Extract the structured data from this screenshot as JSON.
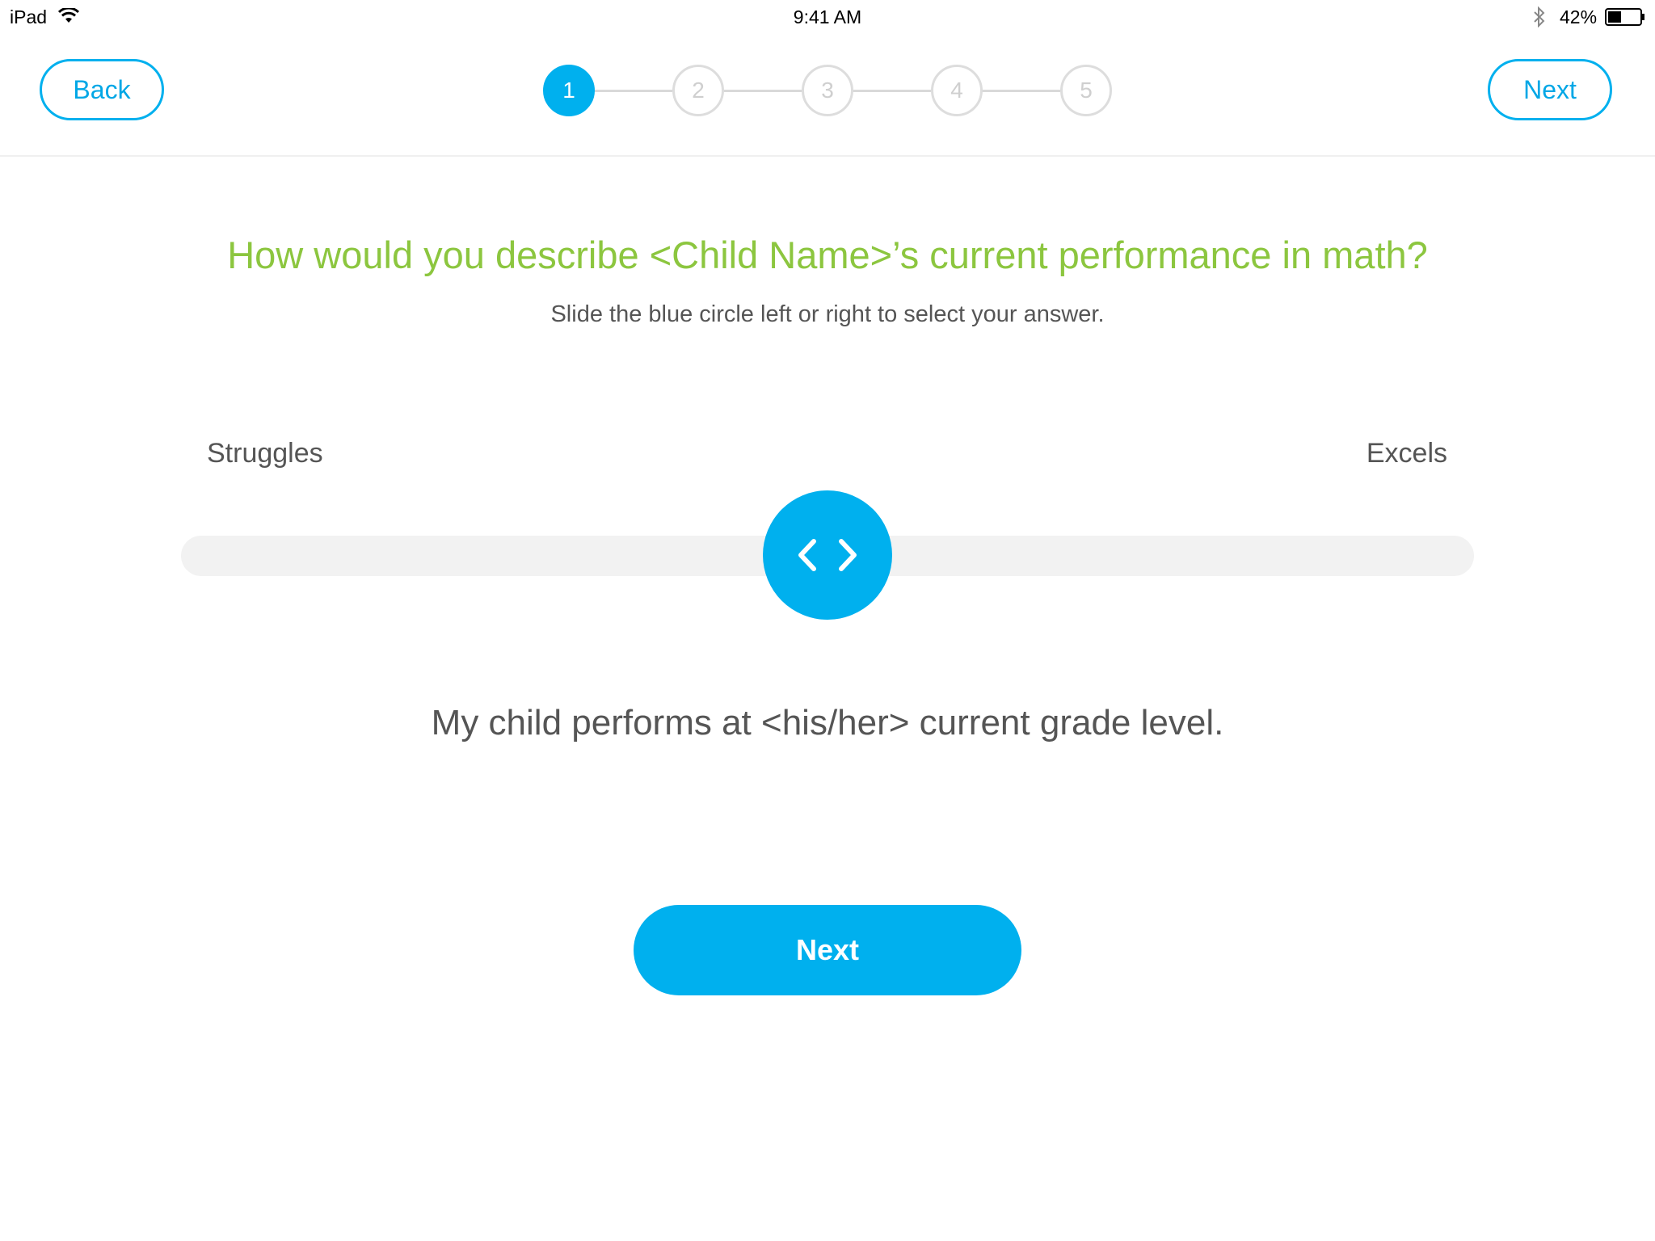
{
  "status_bar": {
    "device": "iPad",
    "time": "9:41 AM",
    "battery_percent": "42%",
    "battery_level": 0.42
  },
  "header": {
    "back_label": "Back",
    "next_label": "Next",
    "steps": [
      "1",
      "2",
      "3",
      "4",
      "5"
    ],
    "current_step": 1
  },
  "question": {
    "title": "How would you describe <Child Name>’s current performance in math?",
    "instruction": "Slide the blue circle left or right to select your answer."
  },
  "slider": {
    "min_label": "Struggles",
    "max_label": "Excels",
    "value": 0.5
  },
  "answer_text": "My child performs at <his/her> current grade level.",
  "next_button_label": "Next",
  "colors": {
    "accent": "#00b0ee",
    "question": "#8cc63f",
    "text": "#555555",
    "track": "#f2f2f2",
    "step_inactive": "#dddddd"
  }
}
